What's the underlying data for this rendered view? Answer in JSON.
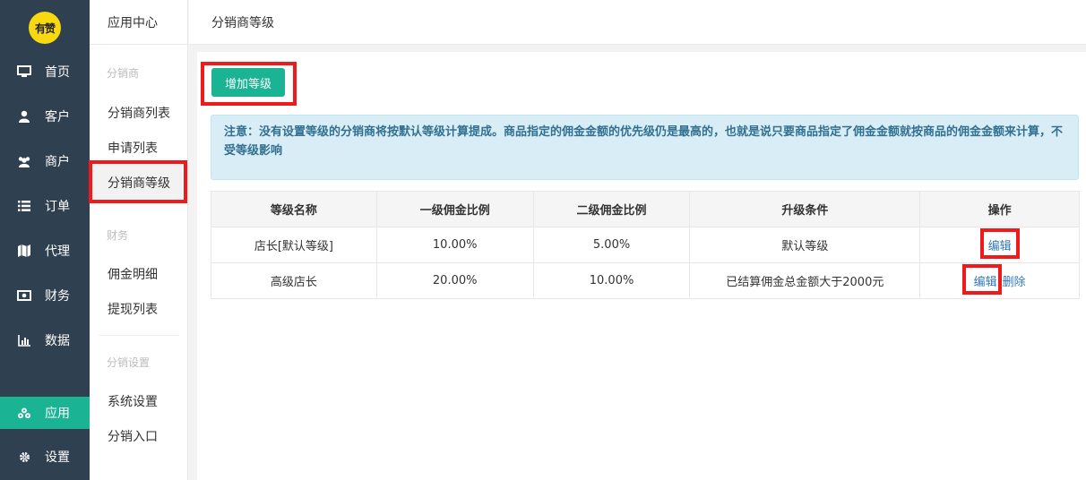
{
  "logo": {
    "text": "有赞"
  },
  "nav": {
    "items": [
      {
        "label": "首页",
        "icon": "monitor-icon"
      },
      {
        "label": "客户",
        "icon": "user-icon"
      },
      {
        "label": "商户",
        "icon": "users-icon"
      },
      {
        "label": "订单",
        "icon": "list-icon"
      },
      {
        "label": "代理",
        "icon": "map-icon"
      },
      {
        "label": "财务",
        "icon": "money-icon"
      },
      {
        "label": "数据",
        "icon": "bar-chart-icon"
      },
      {
        "label": "应用",
        "icon": "cubes-icon",
        "active": true
      },
      {
        "label": "设置",
        "icon": "gear-icon"
      }
    ],
    "active_color": "#1ab394"
  },
  "subnav": {
    "title": "应用中心",
    "groups": {
      "distributor": "分销商",
      "finance": "财务",
      "settings": "分销设置"
    },
    "links": {
      "distributor_list": "分销商列表",
      "application_list": "申请列表",
      "distributor_level": "分销商等级",
      "commission_detail": "佣金明细",
      "withdraw_list": "提现列表",
      "system_settings": "系统设置",
      "distribution_entry": "分销入口"
    }
  },
  "topbar": {
    "title": "分销商等级"
  },
  "toolbar": {
    "add_level_label": "增加等级"
  },
  "notice": {
    "text": "注意：没有设置等级的分销商将按默认等级计算提成。商品指定的佣金金额的优先级仍是最高的，也就是说只要商品指定了佣金金额就按商品的佣金金额来计算，不受等级影响"
  },
  "table": {
    "headers": [
      "等级名称",
      "一级佣金比例",
      "二级佣金比例",
      "升级条件",
      "操作"
    ],
    "rows": [
      {
        "name": "店长[默认等级]",
        "level1": "10.00%",
        "level2": "5.00%",
        "condition": "默认等级",
        "edit": "编辑"
      },
      {
        "name": "高级店长",
        "level1": "20.00%",
        "level2": "10.00%",
        "condition": "已结算佣金总金额大于2000元",
        "edit": "编辑",
        "delete": "删除"
      }
    ]
  },
  "colors": {
    "sidebar": "#2f4050",
    "accent": "#1ab394",
    "highlight": "#f01a1a",
    "link": "#337ab7"
  }
}
